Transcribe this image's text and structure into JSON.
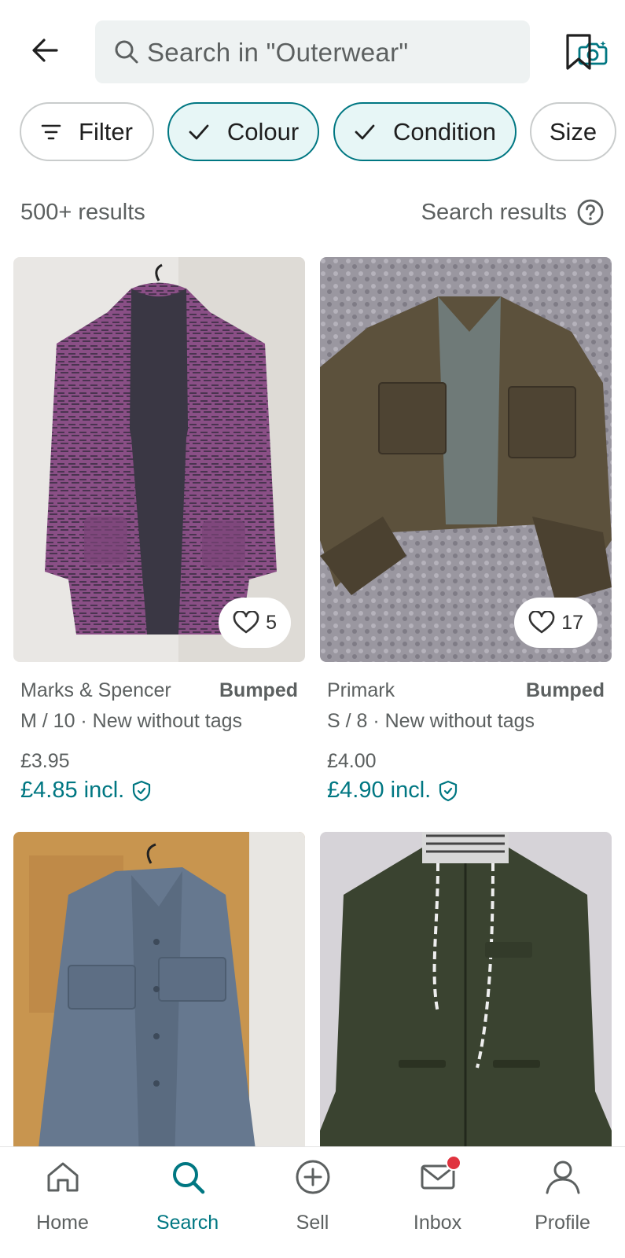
{
  "header": {
    "back_icon": "arrow-left-icon",
    "search_placeholder": "Search in \"Outerwear\"",
    "search_icon": "search-icon",
    "camera_icon": "camera-search-icon",
    "bookmark_icon": "bookmark-icon"
  },
  "filters": {
    "chips": [
      {
        "label": "Filter",
        "icon": "filter-icon",
        "active": false
      },
      {
        "label": "Colour",
        "icon": "check-icon",
        "active": true
      },
      {
        "label": "Condition",
        "icon": "check-icon",
        "active": true
      },
      {
        "label": "Size",
        "icon": "",
        "active": false
      }
    ]
  },
  "results": {
    "count": "500+ results",
    "sort_label": "Search results",
    "help_icon": "help-circle-icon"
  },
  "items": [
    {
      "brand": "Marks & Spencer",
      "bumped": "Bumped",
      "details": "M / 10 · New without tags",
      "price": "£3.95",
      "price_incl": "£4.85 incl.",
      "favourites": "5",
      "image_desc": "purple knit coat on hanger"
    },
    {
      "brand": "Primark",
      "bumped": "Bumped",
      "details": "S / 8 · New without tags",
      "price": "£4.00",
      "price_incl": "£4.90 incl.",
      "favourites": "17",
      "image_desc": "brown faux leather cropped jacket on fluffy rug"
    },
    {
      "image_desc": "grey-blue wool shacket on door"
    },
    {
      "image_desc": "khaki green zip parka with striped hood"
    }
  ],
  "nav": {
    "items": [
      {
        "label": "Home",
        "icon": "home-icon",
        "active": false
      },
      {
        "label": "Search",
        "icon": "search-icon",
        "active": true
      },
      {
        "label": "Sell",
        "icon": "plus-circle-icon",
        "active": false
      },
      {
        "label": "Inbox",
        "icon": "mail-icon",
        "active": false,
        "badge": true
      },
      {
        "label": "Profile",
        "icon": "person-icon",
        "active": false
      }
    ]
  },
  "colors": {
    "accent": "#007782",
    "chip_active_bg": "#e7f6f6",
    "badge": "#e0333f",
    "muted_text": "#5c6060"
  }
}
